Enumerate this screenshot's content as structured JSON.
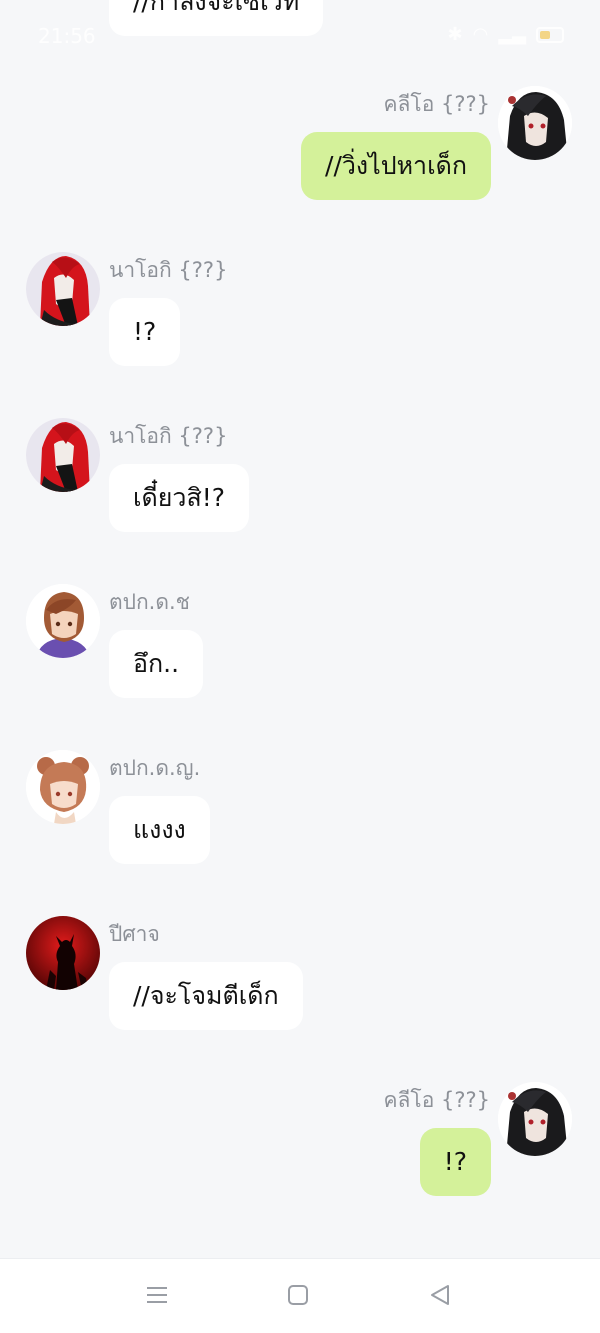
{
  "status_bar": {
    "time": "21:56"
  },
  "messages": [
    {
      "direction": "in",
      "text": "//กำลังจะเซเว็ท"
    },
    {
      "direction": "out",
      "sender": "คลีโอ {??}",
      "text": "//วิ่งไปหาเด็ก",
      "avatar_icon": "dark-hair-character-avatar"
    },
    {
      "direction": "in",
      "sender": "นาโอกิ {??}",
      "text": "!?",
      "avatar_icon": "red-hair-character-avatar"
    },
    {
      "direction": "in",
      "sender": "นาโอกิ {??}",
      "text": "เดี๋ยวสิ!?",
      "avatar_icon": "red-hair-character-avatar"
    },
    {
      "direction": "in",
      "sender": "ตปก.ด.ช",
      "text": "อึก..",
      "avatar_icon": "brown-hair-boy-avatar"
    },
    {
      "direction": "in",
      "sender": "ตปก.ด.ญ.",
      "text": "แงงง",
      "avatar_icon": "brown-hair-girl-avatar"
    },
    {
      "direction": "in",
      "sender": "ปีศาจ",
      "text": "//จะโจมตีเด็ก",
      "avatar_icon": "demon-silhouette-avatar"
    },
    {
      "direction": "out",
      "sender": "คลีโอ {??}",
      "text": "!?",
      "avatar_icon": "dark-hair-character-avatar"
    }
  ],
  "nav_bar": {
    "menu_icon": "menu-lines-icon",
    "home_icon": "square-home-icon",
    "back_icon": "triangle-back-icon"
  },
  "colors": {
    "background": "#f6f7f9",
    "incoming_bubble": "#ffffff",
    "outgoing_bubble": "#d4f19a",
    "sender_name": "#8d9198"
  }
}
